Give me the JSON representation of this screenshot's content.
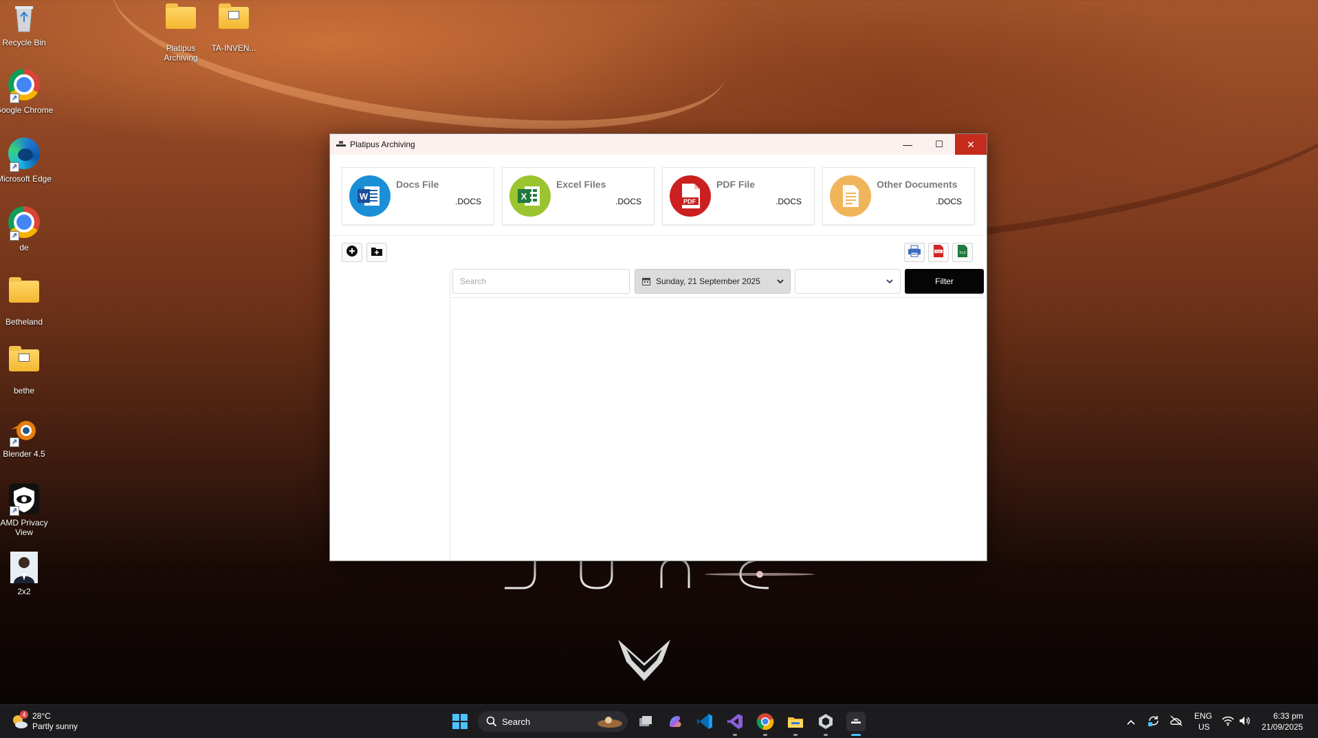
{
  "desktop": {
    "icons": [
      {
        "label": "Recycle Bin"
      },
      {
        "label": "Platipus Archiving"
      },
      {
        "label": "TA-INVEN..."
      },
      {
        "label": "Google Chrome"
      },
      {
        "label": "Microsoft Edge"
      },
      {
        "label": "de"
      },
      {
        "label": "Betheland"
      },
      {
        "label": "bethe"
      },
      {
        "label": "Blender 4.5"
      },
      {
        "label": "AMD Privacy View"
      },
      {
        "label": "2x2"
      }
    ]
  },
  "window": {
    "title": "Platipus Archiving",
    "controls": {
      "minimize": "—",
      "maximize": "☐",
      "close": "✕"
    },
    "cards": [
      {
        "title": "Docs File",
        "ext": ".DOCS",
        "badge": "W",
        "color": "#1b8fd6"
      },
      {
        "title": "Excel Files",
        "ext": ".DOCS",
        "badge": "X",
        "color": "#9bc42e"
      },
      {
        "title": "PDF File",
        "ext": ".DOCS",
        "badge": "PDF",
        "color": "#cc1f1f"
      },
      {
        "title": "Other Documents",
        "ext": ".DOCS",
        "badge": "",
        "color": "#f0b55a"
      }
    ],
    "filters": {
      "search_placeholder": "Search",
      "date_value": "Sunday, 21 September 2025",
      "combo_value": "",
      "filter_label": "Filter"
    }
  },
  "taskbar": {
    "weather": {
      "temp": "28°C",
      "desc": "Partly sunny",
      "badge": "4"
    },
    "search_label": "Search",
    "tray": {
      "lang": "ENG",
      "region": "US",
      "time": "6:33 pm",
      "date": "21/09/2025"
    }
  }
}
